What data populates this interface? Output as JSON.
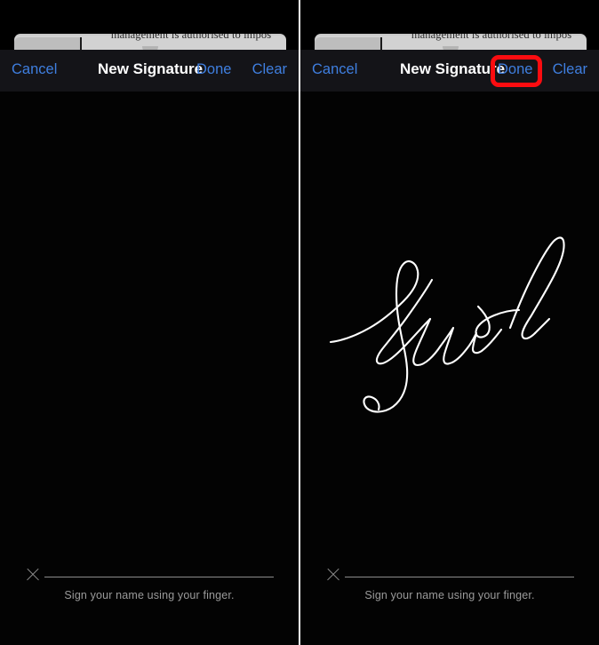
{
  "screen": {
    "title": "New Signature",
    "background_color": "#000000",
    "accent_color": "#3f7fe0",
    "highlight_color": "#fb0c10"
  },
  "document_behind": {
    "visible_text": "management is authorised to impos"
  },
  "panels": [
    {
      "id": "before",
      "toolbar": {
        "cancel_label": "Cancel",
        "title": "New Signature",
        "done_label": "Done",
        "clear_label": "Clear"
      },
      "canvas": {
        "has_signature": false,
        "signature_name": ""
      },
      "footer": {
        "x_icon": "x-mark-icon",
        "hint": "Sign your name using your finger."
      },
      "highlight": {
        "visible": false,
        "target": ""
      }
    },
    {
      "id": "after",
      "toolbar": {
        "cancel_label": "Cancel",
        "title": "New Signature",
        "done_label": "Done",
        "clear_label": "Clear"
      },
      "canvas": {
        "has_signature": true,
        "signature_name": "Kaushal"
      },
      "footer": {
        "x_icon": "x-mark-icon",
        "hint": "Sign your name using your finger."
      },
      "highlight": {
        "visible": true,
        "target": "Done"
      }
    }
  ]
}
